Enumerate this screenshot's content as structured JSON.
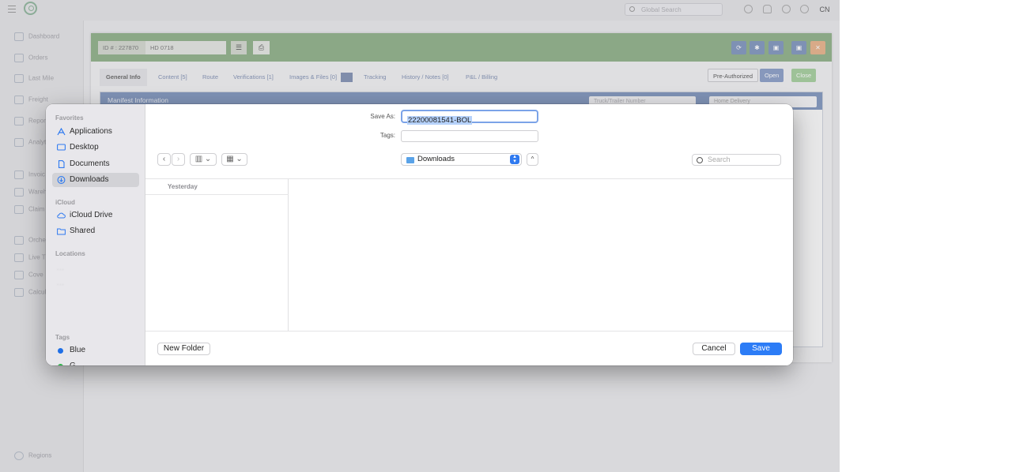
{
  "app": {
    "avatar": "CN",
    "global_search_placeholder": "Global Search",
    "sidebar": [
      {
        "label": "Dashboard"
      },
      {
        "label": "Orders"
      },
      {
        "label": "Last Mile"
      },
      {
        "label": "Freight"
      },
      {
        "label": "Repor"
      },
      {
        "label": "Analyt"
      },
      {
        "label": "Invoic"
      },
      {
        "label": "Wareh"
      },
      {
        "label": "Claim"
      },
      {
        "label": "Orche"
      },
      {
        "label": "Live T"
      },
      {
        "label": "Cove"
      },
      {
        "label": "Calcul"
      },
      {
        "label": "Regions"
      }
    ],
    "order": {
      "id_label": "ID # : 227870",
      "hd_value": "HD 0718",
      "tabs": [
        "General Info",
        "Content [5]",
        "Route",
        "Verifications [1]",
        "Images & Files [0]",
        "Tracking",
        "History / Notes [0]",
        "P&L / Billing"
      ],
      "pre_authorized": "Pre-Authorized",
      "open": "Open",
      "close": "Close",
      "manifest_title": "Manifest Information",
      "truck_placeholder": "Truck/Trailer Number",
      "delivery_type": "Home Delivery"
    }
  },
  "dialog": {
    "save_as_label": "Save As:",
    "save_as_value": "22200081541-BOL",
    "tags_label": "Tags:",
    "location": "Downloads",
    "search_placeholder": "Search",
    "favorites_header": "Favorites",
    "favorites": [
      {
        "label": "Applications",
        "icon": "applications-icon"
      },
      {
        "label": "Desktop",
        "icon": "desktop-icon"
      },
      {
        "label": "Documents",
        "icon": "document-icon"
      },
      {
        "label": "Downloads",
        "icon": "downloads-icon",
        "selected": true
      }
    ],
    "icloud_header": "iCloud",
    "icloud": [
      {
        "label": "iCloud Drive",
        "icon": "cloud-icon"
      },
      {
        "label": "Shared",
        "icon": "shared-folder-icon"
      }
    ],
    "locations_header": "Locations",
    "locations": [
      "...",
      "..."
    ],
    "tags_header": "Tags",
    "tags": [
      {
        "label": "Blue",
        "color": "#1f6fe6"
      },
      {
        "label": "G",
        "color": "#2fb54a"
      }
    ],
    "group_header": "Yesterday",
    "new_folder": "New Folder",
    "cancel": "Cancel",
    "save": "Save"
  }
}
